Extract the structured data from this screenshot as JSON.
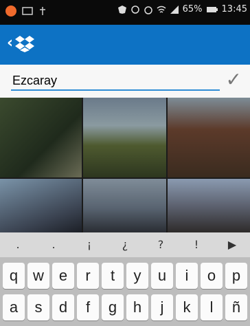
{
  "status_bar": {
    "battery_percent": "65%",
    "time": "13:45"
  },
  "top_bar": {
    "back_icon": "chevron-left-icon",
    "logo_icon": "dropbox-logo-icon",
    "accent": "#0d72c4"
  },
  "rename": {
    "value": "Ezcaray",
    "confirm_icon": "checkmark-icon"
  },
  "photos": {
    "tiles": [
      "photo-1",
      "photo-2",
      "photo-3",
      "photo-4",
      "photo-5",
      "photo-6"
    ]
  },
  "keyboard": {
    "suggestions": [
      ".",
      ".",
      "¡",
      "¿",
      "?",
      "!",
      "▶"
    ],
    "row1": [
      "q",
      "w",
      "e",
      "r",
      "t",
      "y",
      "u",
      "i",
      "o",
      "p"
    ],
    "row2": [
      "a",
      "s",
      "d",
      "f",
      "g",
      "h",
      "j",
      "k",
      "l",
      "ñ"
    ]
  }
}
